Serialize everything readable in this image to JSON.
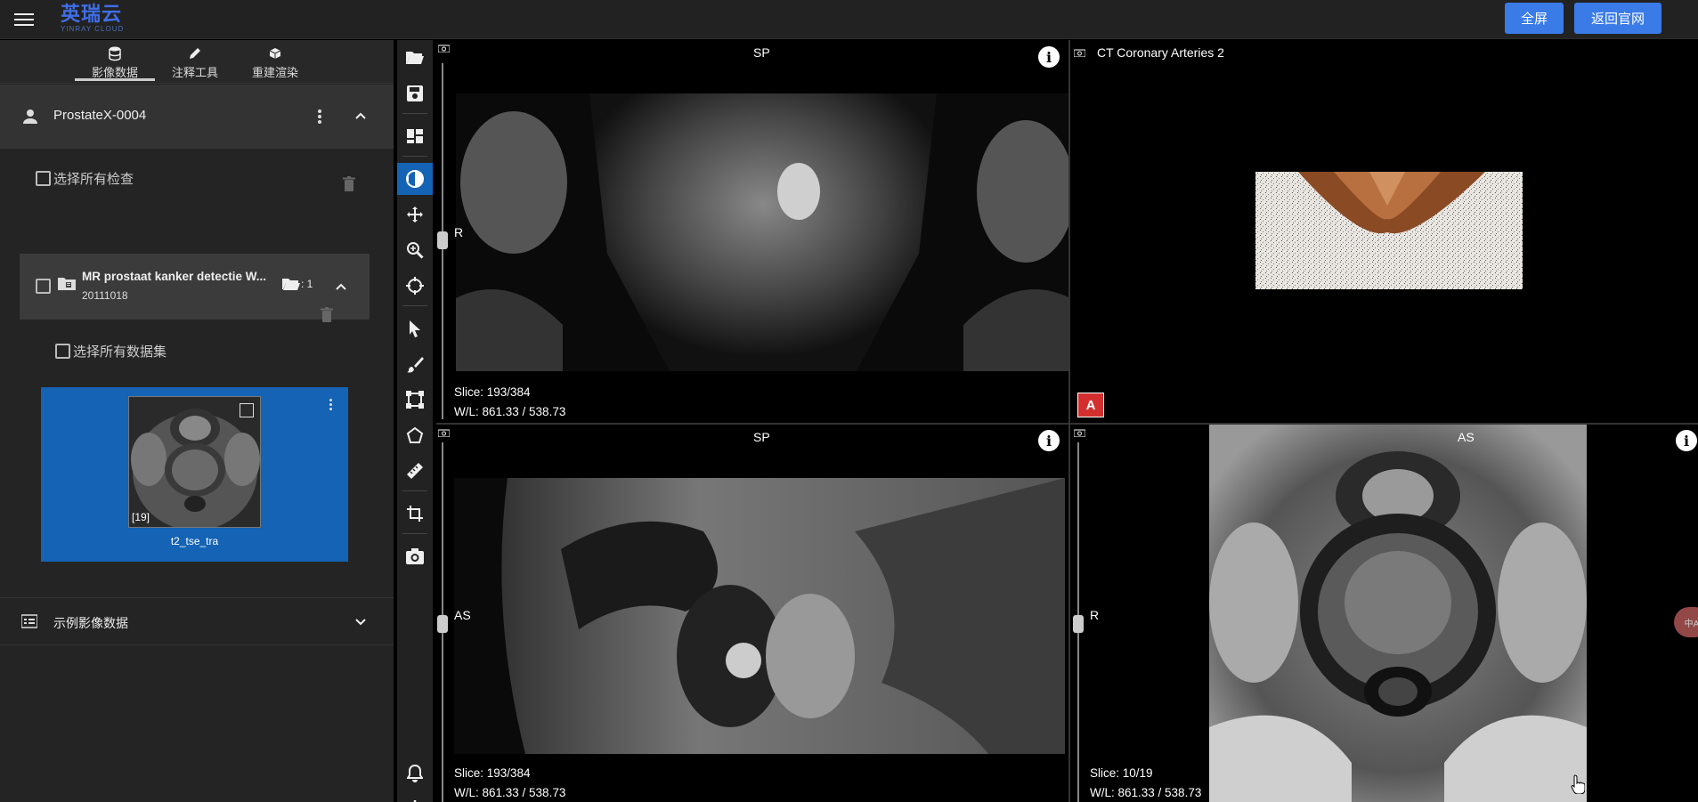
{
  "header": {
    "logo_cn": "英瑞云",
    "logo_en": "YINRAY CLOUD",
    "fullscreen_label": "全屏",
    "home_label": "返回官网"
  },
  "left_tabs": [
    {
      "label": "影像数据",
      "icon": "database-icon"
    },
    {
      "label": "注释工具",
      "icon": "pencil-icon"
    },
    {
      "label": "重建渲染",
      "icon": "cube-icon"
    }
  ],
  "patient": {
    "name": "ProstateX-0004"
  },
  "select_all_studies": "选择所有检查",
  "study": {
    "title": "MR prostaat kanker detectie W...",
    "date": "20111018",
    "count": ": 1"
  },
  "select_all_series": "选择所有数据集",
  "series": {
    "label": "t2_tse_tra",
    "count": "[19]"
  },
  "example_section": {
    "label": "示例影像数据"
  },
  "viewports": {
    "top_left": {
      "top_label": "SP",
      "left_label": "R",
      "slice": "Slice: 193/384",
      "wl": "W/L: 861.33 / 538.73"
    },
    "top_right": {
      "title": "CT Coronary Arteries 2",
      "badge": "A"
    },
    "bottom_left": {
      "top_label": "SP",
      "left_label": "AS",
      "slice": "Slice: 193/384",
      "wl": "W/L: 861.33 / 538.73"
    },
    "bottom_right": {
      "top_label": "AS",
      "left_label": "R",
      "slice": "Slice: 10/19",
      "wl": "W/L: 861.33 / 538.73"
    }
  },
  "lang_badge": "中A",
  "colors": {
    "accent": "#3a7be8",
    "selected": "#1463b4",
    "header_bg": "#222222",
    "badge_red": "#d32f2f"
  }
}
